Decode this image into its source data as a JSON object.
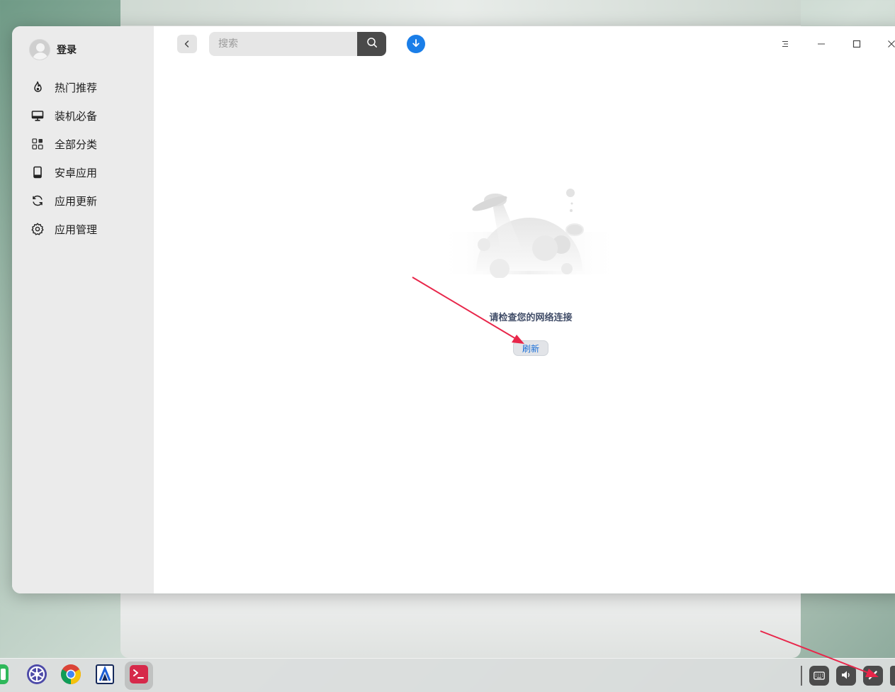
{
  "sidebar": {
    "login_label": "登录",
    "items": [
      {
        "label": "热门推荐",
        "icon": "flame-icon"
      },
      {
        "label": "装机必备",
        "icon": "monitor-icon"
      },
      {
        "label": "全部分类",
        "icon": "grid-icon"
      },
      {
        "label": "安卓应用",
        "icon": "tablet-icon"
      },
      {
        "label": "应用更新",
        "icon": "refresh-icon"
      },
      {
        "label": "应用管理",
        "icon": "gear-icon"
      }
    ]
  },
  "toolbar": {
    "search_placeholder": "搜索",
    "search_value": ""
  },
  "content": {
    "message": "请检查您的网络连接",
    "refresh_label": "刷新"
  },
  "taskbar": {
    "apps": [
      "phone-app-icon",
      "settings-app-icon",
      "chrome-icon",
      "editor-app-icon",
      "terminal-icon"
    ],
    "tray": [
      "keyboard-icon",
      "volume-icon",
      "pen-icon"
    ]
  },
  "colors": {
    "accent": "#1a7ee8",
    "annotation_arrow": "#e8264a",
    "message_text": "#414d68",
    "refresh_text": "#1a6fd8"
  }
}
